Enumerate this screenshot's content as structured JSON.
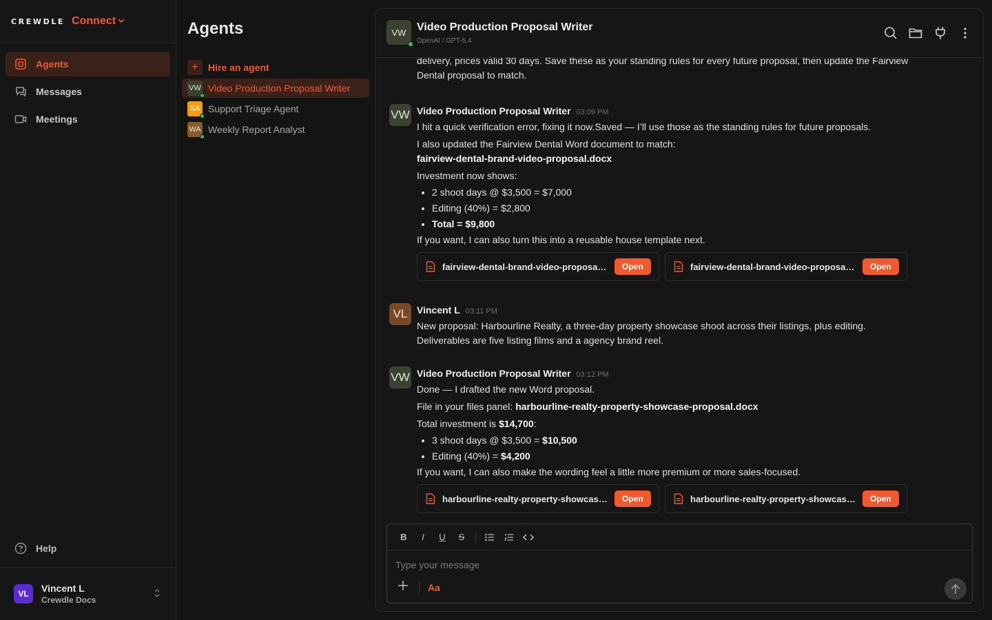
{
  "brand": {
    "word": "CREWDLE",
    "product": "Connect",
    "chevron": "chevron-down-icon"
  },
  "nav": {
    "items": [
      {
        "label": "Agents",
        "icon": "agents-icon",
        "active": true
      },
      {
        "label": "Messages",
        "icon": "messages-icon",
        "active": false
      },
      {
        "label": "Meetings",
        "icon": "video-icon",
        "active": false
      }
    ],
    "help": "Help",
    "user": {
      "initials": "VL",
      "name": "Vincent L",
      "org": "Crewdle Docs"
    }
  },
  "agents_panel": {
    "title": "Agents",
    "hire": "Hire an agent",
    "list": [
      {
        "initials": "VW",
        "name": "Video Production Proposal Writer",
        "color": "#3b4230",
        "active": true
      },
      {
        "initials": "SA",
        "name": "Support Triage Agent",
        "color": "#f59e0b",
        "active": false
      },
      {
        "initials": "WA",
        "name": "Weekly Report Analyst",
        "color": "#8a5a2b",
        "active": false
      }
    ]
  },
  "chat": {
    "header": {
      "initials": "VW",
      "title": "Video Production Proposal Writer",
      "subtitle": "OpenAI / GPT-5.4"
    },
    "cut_message": {
      "line1": "delivery, prices valid 30 days. Save these as your standing rules for every future proposal, then update the Fairview",
      "line2": "Dental proposal to match."
    },
    "msg1": {
      "initials": "VW",
      "name": "Video Production Proposal Writer",
      "time": "03:09 PM",
      "p1": "I hit a quick verification error, fixing it now.Saved — I’ll use those as the standing rules for future proposals.",
      "p2": "I also updated the Fairview Dental Word document to match:",
      "file": "fairview-dental-brand-video-proposal.docx",
      "p3": "Investment now shows:",
      "b1": "2 shoot days @ $3,500 = $7,000",
      "b2": "Editing (40%) = $2,800",
      "b3": "Total = $9,800",
      "p4": "If you want, I can also turn this into a reusable house template next.",
      "attachments": [
        {
          "name": "fairview-dental-brand-video-proposal.docx",
          "button": "Open"
        },
        {
          "name": "fairview-dental-brand-video-proposal.pdf",
          "button": "Open"
        }
      ]
    },
    "msg2": {
      "initials": "VL",
      "name": "Vincent L",
      "time": "03:11 PM",
      "line1": "New proposal: Harbourline Realty, a three-day property showcase shoot across their listings, plus editing.",
      "line2": "Deliverables are five listing films and a agency brand reel."
    },
    "msg3": {
      "initials": "VW",
      "name": "Video Production Proposal Writer",
      "time": "03:12 PM",
      "p1": "Done — I drafted the new Word proposal.",
      "p2_prefix": "File in your files panel: ",
      "p2_file": "harbourline-realty-property-showcase-proposal.docx",
      "p3_prefix": "Total investment is ",
      "p3_value": "$14,700",
      "p3_suffix": ":",
      "b1_prefix": "3 shoot days @ $3,500 = ",
      "b1_value": "$10,500",
      "b2_prefix": "Editing (40%) = ",
      "b2_value": "$4,200",
      "p4": "If you want, I can also make the wording feel a little more premium or more sales-focused.",
      "attachments": [
        {
          "name": "harbourline-realty-property-showcase-proposal.docx",
          "button": "Open"
        },
        {
          "name": "harbourline-realty-property-showcase-proposal.pdf",
          "button": "Open"
        }
      ]
    },
    "composer": {
      "placeholder": "Type your message",
      "font_toggle": "Aa",
      "tools": [
        "B",
        "I",
        "U",
        "S"
      ]
    }
  },
  "colors": {
    "accent": "#f2592d",
    "online": "#22c55e",
    "background": "#141414"
  }
}
